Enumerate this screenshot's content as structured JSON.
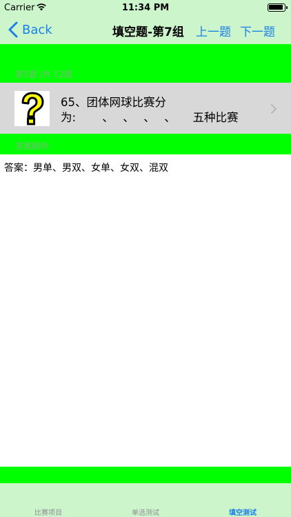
{
  "status_bar": {
    "carrier": "Carrier",
    "time": "11:34 PM",
    "wifi_icon": "wifi-icon",
    "battery_icon": "battery-icon"
  },
  "nav": {
    "back_label": "Back",
    "title": "填空题-第7组",
    "prev_label": "上一题",
    "next_label": "下一题"
  },
  "progress_text": "第5题 /共 12题",
  "question": {
    "icon": "question-mark-icon",
    "line1": "65、团体网球比赛分",
    "line2": "为:　　 、　 、　 、　 、　　五种比赛"
  },
  "answer_section_label": "答案解析:",
  "answer_text": "答案：男单、男双、女单、女双、混双",
  "tabs": [
    {
      "label": "比赛项目",
      "active": false
    },
    {
      "label": "单选测试",
      "active": false
    },
    {
      "label": "填空测试",
      "active": true
    }
  ],
  "colors": {
    "accent": "#1a7fe6",
    "green_band": "#00ff00",
    "bar_background": "#ccf5cc",
    "row_background": "#d8d8d8",
    "muted_label": "#7ab87a"
  }
}
